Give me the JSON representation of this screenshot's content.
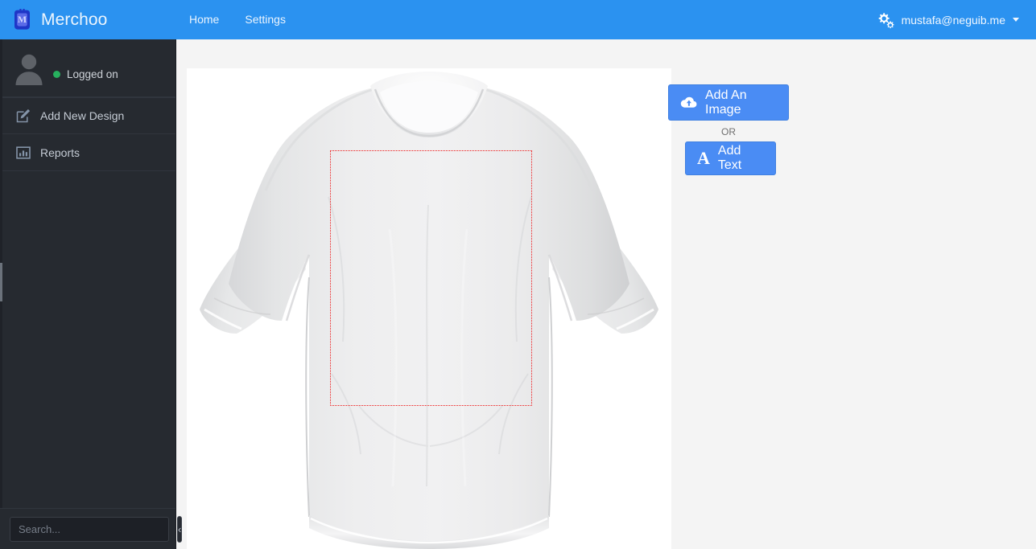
{
  "brand": {
    "name": "Merchoo",
    "logo_icon": "merchoo-tag-logo"
  },
  "navbar": {
    "links": [
      {
        "label": "Home",
        "icon": ""
      },
      {
        "label": "Settings",
        "icon": ""
      }
    ],
    "user": {
      "icon": "cogs-icon",
      "email": "mustafa@neguib.me",
      "caret_icon": "caret-down-icon"
    },
    "bg_color": "#2b92f0"
  },
  "sidebar": {
    "profile": {
      "avatar_icon": "user-avatar-icon",
      "status_label": "Logged on",
      "status_color": "#27b05e"
    },
    "items": [
      {
        "label": "Add New Design",
        "icon": "pencil-square-icon"
      },
      {
        "label": "Reports",
        "icon": "bar-chart-icon"
      }
    ],
    "footer": {
      "search_placeholder": "Search...",
      "search_value": "",
      "collapse_icon": "chevron-left-icon",
      "collapse_label": "‹"
    },
    "bg_color": "#262a30"
  },
  "editor": {
    "canvas": {
      "product": "white-t-shirt",
      "print_area_label": "print-area",
      "print_area_color": "#ee1b1b"
    },
    "tools": {
      "add_image_label": "Add An Image",
      "add_image_icon": "cloud-upload-icon",
      "or_label": "OR",
      "add_text_label": "Add Text",
      "add_text_icon": "font-A-icon",
      "button_color": "#4a8cf4"
    }
  }
}
